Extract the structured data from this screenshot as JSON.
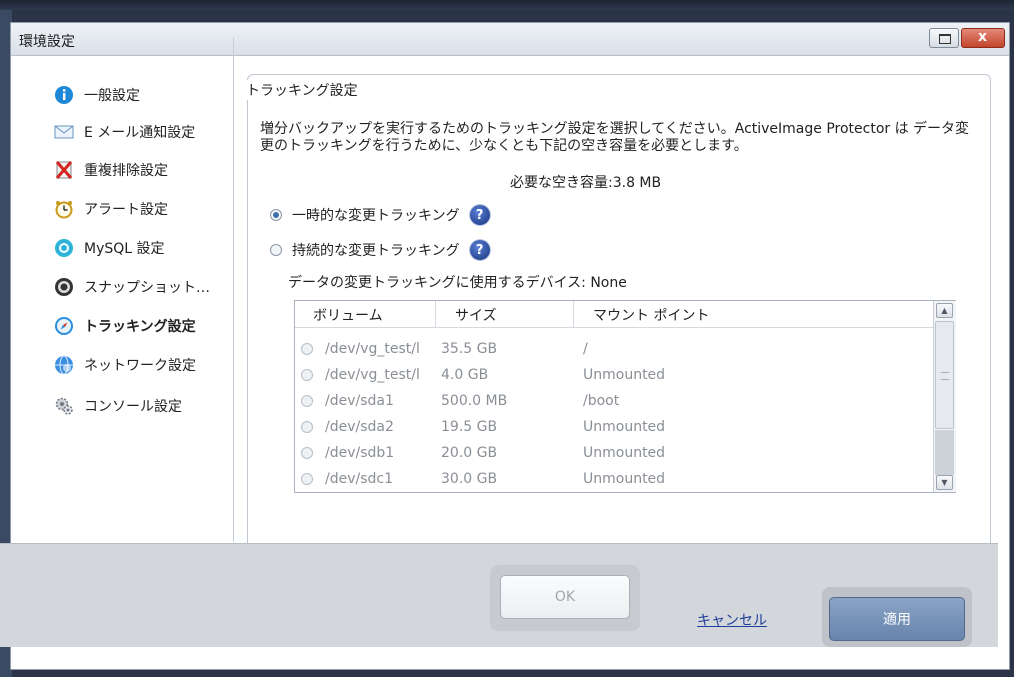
{
  "window": {
    "title": "環境設定",
    "close_glyph": "x"
  },
  "sidebar": {
    "items": [
      {
        "label": "一般設定",
        "icon": "info-icon"
      },
      {
        "label": "E メール通知設定",
        "icon": "envelope-icon"
      },
      {
        "label": "重複排除設定",
        "icon": "dedupe-icon"
      },
      {
        "label": "アラート設定",
        "icon": "alarm-clock-icon"
      },
      {
        "label": "MySQL 設定",
        "icon": "mysql-icon"
      },
      {
        "label": "スナップショット…",
        "icon": "snapshot-icon"
      },
      {
        "label": "トラッキング設定",
        "icon": "compass-icon",
        "active": true
      },
      {
        "label": "ネットワーク設定",
        "icon": "network-globe-icon"
      },
      {
        "label": "コンソール設定",
        "icon": "gears-icon"
      }
    ]
  },
  "tracking": {
    "group_title": "トラッキング設定",
    "description": "増分バックアップを実行するためのトラッキング設定を選択してください。ActiveImage Protector は データ変更のトラッキングを行うために、少なくとも下記の空き容量を必要とします。",
    "required_space": "必要な空き容量:3.8 MB",
    "options": [
      {
        "label": "一時的な変更トラッキング",
        "selected": true
      },
      {
        "label": "持続的な変更トラッキング",
        "selected": false
      }
    ],
    "help_glyph": "?",
    "device_line": "データの変更トラッキングに使用するデバイス:  None",
    "table": {
      "columns": [
        "ボリューム",
        "サイズ",
        "マウント ポイント"
      ],
      "rows": [
        {
          "volume": "/dev/vg_test/l",
          "size": "35.5 GB",
          "mount": "/"
        },
        {
          "volume": "/dev/vg_test/l",
          "size": "4.0 GB",
          "mount": "Unmounted"
        },
        {
          "volume": "/dev/sda1",
          "size": "500.0 MB",
          "mount": "/boot"
        },
        {
          "volume": "/dev/sda2",
          "size": "19.5 GB",
          "mount": "Unmounted"
        },
        {
          "volume": "/dev/sdb1",
          "size": "20.0 GB",
          "mount": "Unmounted"
        },
        {
          "volume": "/dev/sdc1",
          "size": "30.0 GB",
          "mount": "Unmounted"
        }
      ]
    }
  },
  "footer": {
    "ok_label": "OK",
    "cancel_label": "キャンセル",
    "apply_label": "適用"
  },
  "colors": {
    "accent": "#3d6fa8",
    "apply_button": "#7690b6",
    "link": "#1f3f9a",
    "disabled_text": "#8a8f96"
  }
}
